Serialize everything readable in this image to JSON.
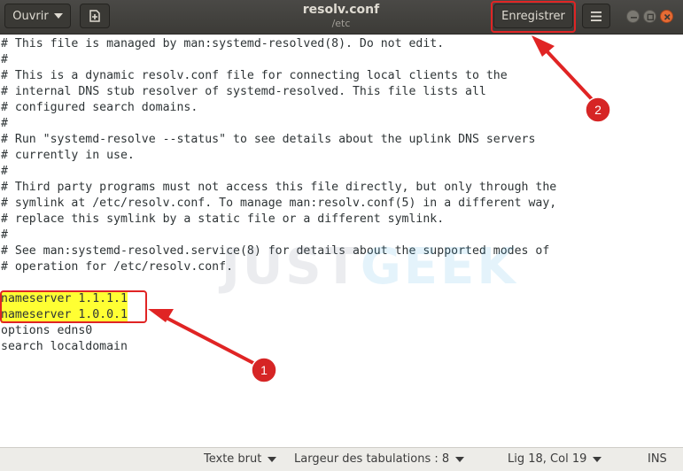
{
  "header": {
    "open_label": "Ouvrir",
    "title": "resolv.conf",
    "subtitle": "/etc",
    "save_label": "Enregistrer"
  },
  "editor": {
    "lines": [
      "# This file is managed by man:systemd-resolved(8). Do not edit.",
      "#",
      "# This is a dynamic resolv.conf file for connecting local clients to the",
      "# internal DNS stub resolver of systemd-resolved. This file lists all",
      "# configured search domains.",
      "#",
      "# Run \"systemd-resolve --status\" to see details about the uplink DNS servers",
      "# currently in use.",
      "#",
      "# Third party programs must not access this file directly, but only through the",
      "# symlink at /etc/resolv.conf. To manage man:resolv.conf(5) in a different way,",
      "# replace this symlink by a static file or a different symlink.",
      "#",
      "# See man:systemd-resolved.service(8) for details about the supported modes of",
      "# operation for /etc/resolv.conf.",
      "",
      "nameserver 1.1.1.1",
      "nameserver 1.0.0.1",
      "options edns0",
      "search localdomain"
    ]
  },
  "watermark": {
    "part1": "JUST",
    "part2": "GEEK"
  },
  "statusbar": {
    "syntax": "Texte brut",
    "tab_width": "Largeur des tabulations : 8",
    "position": "Lig 18, Col 19",
    "mode": "INS"
  },
  "annotations": {
    "marker1": "1",
    "marker2": "2",
    "color": "#e02424"
  },
  "colors": {
    "highlight": "#ffff33",
    "titlebar": "#3c3b37",
    "close": "#e66b34"
  },
  "icons": {
    "new_document": "new-document-icon",
    "menu": "hamburger-menu-icon"
  }
}
